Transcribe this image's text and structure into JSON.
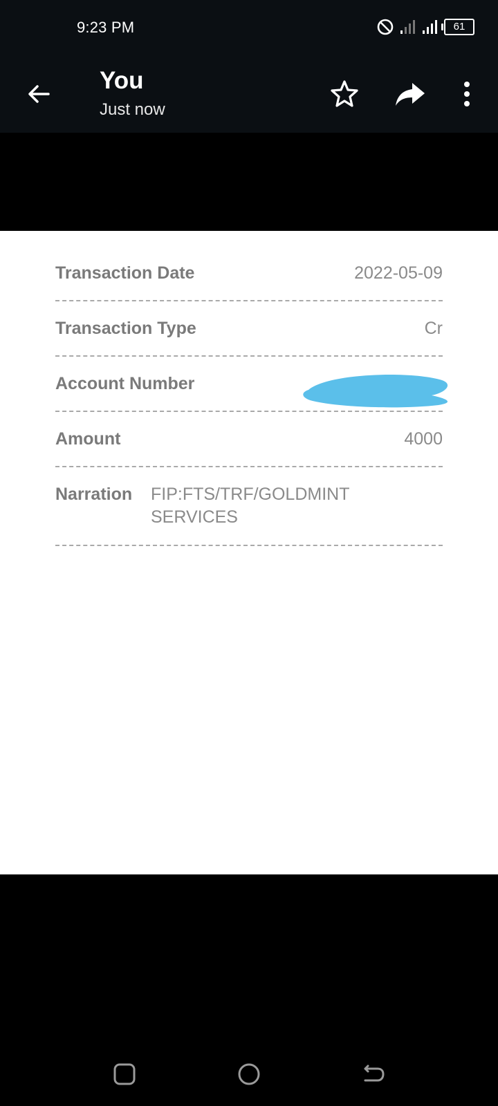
{
  "status_bar": {
    "time": "9:23 PM",
    "battery": "61",
    "icons": [
      "do-not-disturb-icon",
      "signal-weak-icon",
      "signal-icon",
      "battery-icon"
    ]
  },
  "app_bar": {
    "title": "You",
    "subtitle": "Just now",
    "icons": [
      "back-arrow-icon",
      "star-icon",
      "share-icon",
      "more-vert-icon"
    ]
  },
  "receipt": {
    "rows": [
      {
        "label": "Transaction Date",
        "value": "2022-05-09"
      },
      {
        "label": "Transaction Type",
        "value": "Cr"
      },
      {
        "label": "Account Number",
        "value": ""
      },
      {
        "label": "Amount",
        "value": "4000"
      },
      {
        "label": "Narration",
        "value": "FIP:FTS/TRF/GOLDMINT SERVICES"
      }
    ],
    "redaction_color": "#5bbfea"
  },
  "nav_bar": {
    "icons": [
      "recent-apps-icon",
      "home-icon",
      "back-icon"
    ]
  }
}
